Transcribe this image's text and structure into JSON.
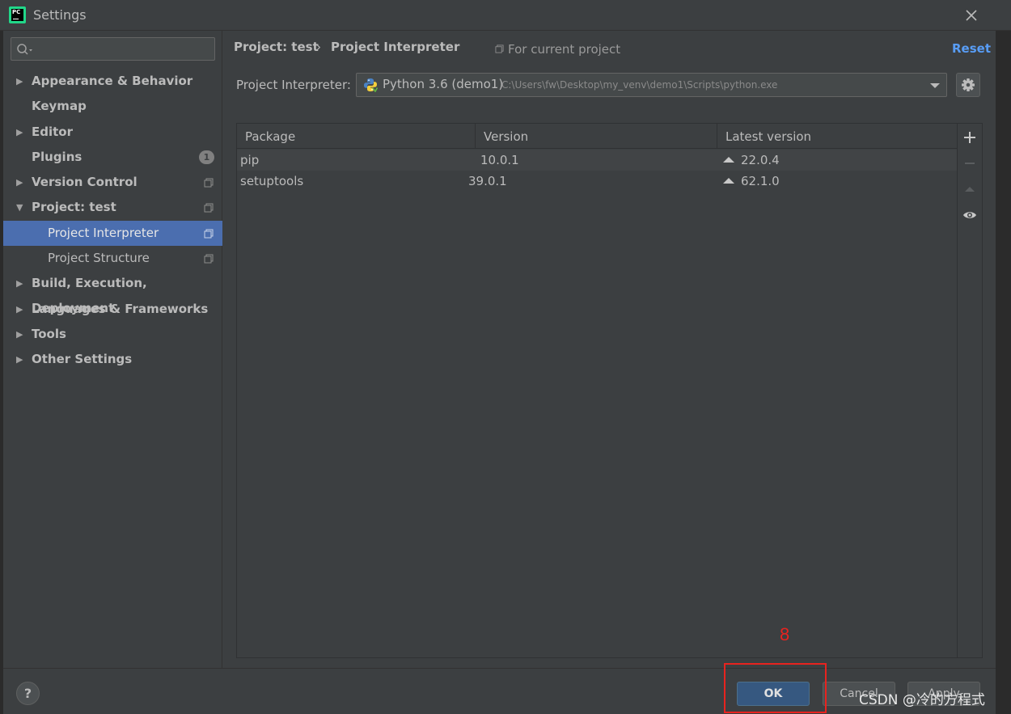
{
  "window": {
    "title": "Settings"
  },
  "search": {
    "placeholder": ""
  },
  "sidebar": {
    "items": [
      {
        "label": "Appearance & Behavior",
        "arrow": "▶"
      },
      {
        "label": "Keymap",
        "arrow": ""
      },
      {
        "label": "Editor",
        "arrow": "▶"
      },
      {
        "label": "Plugins",
        "arrow": "",
        "badge": "1"
      },
      {
        "label": "Version Control",
        "arrow": "▶"
      },
      {
        "label": "Project: test",
        "arrow": "▼"
      },
      {
        "label": "Project Interpreter",
        "arrow": ""
      },
      {
        "label": "Project Structure",
        "arrow": ""
      },
      {
        "label": "Build, Execution, Deployment",
        "arrow": "▶"
      },
      {
        "label": "Languages & Frameworks",
        "arrow": "▶"
      },
      {
        "label": "Tools",
        "arrow": "▶"
      },
      {
        "label": "Other Settings",
        "arrow": "▶"
      }
    ]
  },
  "header": {
    "crumb_parent": "Project: test",
    "crumb_sep": "›",
    "crumb_current": "Project Interpreter",
    "scope": "For current project",
    "reset": "Reset"
  },
  "interpreter": {
    "label": "Project Interpreter:",
    "name": "Python 3.6 (demo1)",
    "path": "C:\\Users\\fw\\Desktop\\my_venv\\demo1\\Scripts\\python.exe"
  },
  "packages": {
    "columns": [
      "Package",
      "Version",
      "Latest version"
    ],
    "rows": [
      {
        "package": "pip",
        "version": "10.0.1",
        "latest": "22.0.4"
      },
      {
        "package": "setuptools",
        "version": "39.0.1",
        "latest": "62.1.0"
      }
    ]
  },
  "buttons": {
    "help": "?",
    "ok": "OK",
    "cancel": "Cancel",
    "apply": "Apply"
  },
  "annotation": {
    "step": "8"
  },
  "watermark": "CSDN @冷的方程式",
  "colors": {
    "accent": "#4b6eaf",
    "ok_button": "#365880",
    "link": "#589df6",
    "annotation": "#e8231f"
  }
}
